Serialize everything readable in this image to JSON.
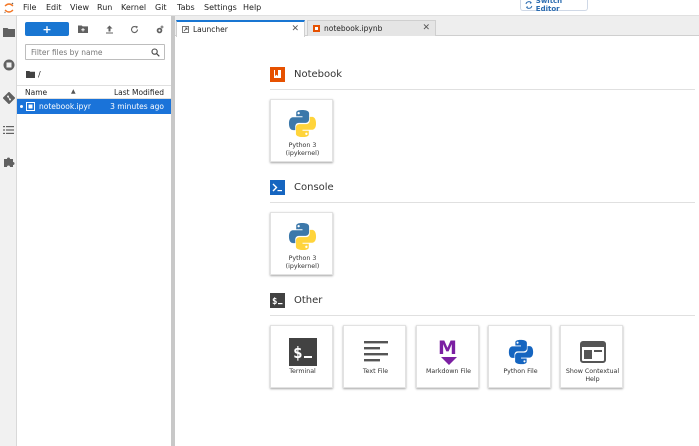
{
  "menubar": {
    "items": [
      "File",
      "Edit",
      "View",
      "Run",
      "Kernel",
      "Git",
      "Tabs",
      "Settings",
      "Help"
    ],
    "switch_editor": "Switch Editor"
  },
  "filebrowser": {
    "new_label": "+",
    "filter_placeholder": "Filter files by name",
    "breadcrumb": "/",
    "columns": {
      "name": "Name",
      "modified": "Last Modified"
    },
    "rows": [
      {
        "name": "notebook.ipynb",
        "modified": "3 minutes ago"
      }
    ]
  },
  "tabs": [
    {
      "label": "Launcher"
    },
    {
      "label": "notebook.ipynb"
    }
  ],
  "launcher": {
    "sections": [
      {
        "title": "Notebook",
        "cards": [
          {
            "label": "Python 3 (ipykernel)"
          }
        ]
      },
      {
        "title": "Console",
        "cards": [
          {
            "label": "Python 3 (ipykernel)"
          }
        ]
      },
      {
        "title": "Other",
        "cards": [
          {
            "label": "Terminal"
          },
          {
            "label": "Text File"
          },
          {
            "label": "Markdown File"
          },
          {
            "label": "Python File"
          },
          {
            "label": "Show Contextual Help"
          }
        ]
      }
    ]
  },
  "icons": {
    "colors": {
      "accent": "#1976d2",
      "notebook": "#e65100",
      "markdown": "#7b1fa2",
      "python_blue": "#3c78aa",
      "python_yellow": "#ffd43b"
    }
  }
}
